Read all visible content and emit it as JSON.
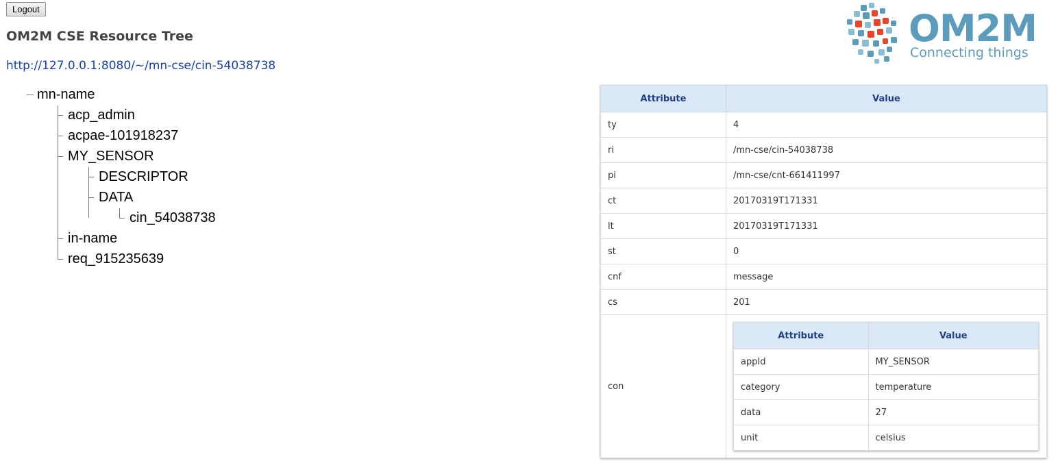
{
  "logout_label": "Logout",
  "page_title": "OM2M CSE Resource Tree",
  "uri": "http://127.0.0.1:8080/~/mn-cse/cin-54038738",
  "logo": {
    "word": "OM2M",
    "tagline": "Connecting things"
  },
  "tree": {
    "root": "mn-name",
    "acp_admin": "acp_admin",
    "acpae": "acpae-101918237",
    "my_sensor": "MY_SENSOR",
    "descriptor": "DESCRIPTOR",
    "data": "DATA",
    "cin": "cin_54038738",
    "in_name": "in-name",
    "req": "req_915235639"
  },
  "table": {
    "header_attr": "Attribute",
    "header_value": "Value",
    "rows": [
      {
        "attr": "ty",
        "value": "4"
      },
      {
        "attr": "ri",
        "value": "/mn-cse/cin-54038738"
      },
      {
        "attr": "pi",
        "value": "/mn-cse/cnt-661411997"
      },
      {
        "attr": "ct",
        "value": "20170319T171331"
      },
      {
        "attr": "lt",
        "value": "20170319T171331"
      },
      {
        "attr": "st",
        "value": "0"
      },
      {
        "attr": "cnf",
        "value": "message"
      },
      {
        "attr": "cs",
        "value": "201"
      }
    ],
    "con_label": "con",
    "con": {
      "header_attr": "Attribute",
      "header_value": "Value",
      "rows": [
        {
          "attr": "appId",
          "value": "MY_SENSOR"
        },
        {
          "attr": "category",
          "value": "temperature"
        },
        {
          "attr": "data",
          "value": "27"
        },
        {
          "attr": "unit",
          "value": "celsius"
        }
      ]
    }
  },
  "colors": {
    "link": "#1641a8",
    "header_bg": "#dae8f7",
    "logo_blue": "#5b9cbd",
    "logo_red": "#e8452c"
  }
}
